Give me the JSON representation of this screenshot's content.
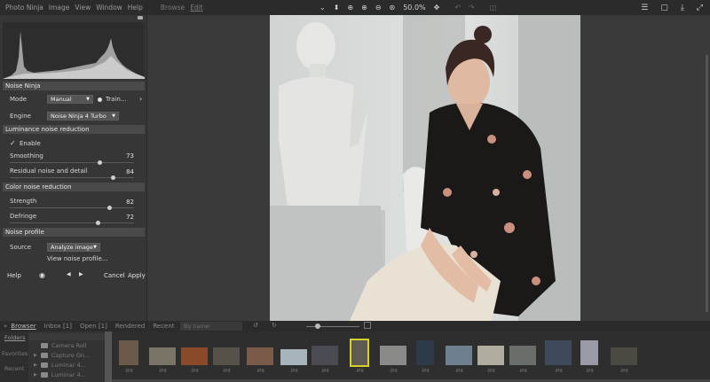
{
  "menu": [
    "Photo Ninja",
    "Image",
    "View",
    "Window",
    "Help"
  ],
  "menu2": [
    "Browse",
    "Edit"
  ],
  "toolbar": {
    "zoom": "50.0%",
    "icons": [
      "pin-icon",
      "zoom-fit-icon",
      "zoom-in-icon",
      "zoom-out-icon",
      "zoom-actual-icon",
      "pan-icon",
      "undo-icon",
      "redo-icon",
      "compare-icon"
    ]
  },
  "panel": {
    "title": "Noise Ninja",
    "mode_label": "Mode",
    "mode_value": "Manual",
    "train_label": "Train...",
    "engine_label": "Engine",
    "engine_value": "Noise Ninja 4 Turbo",
    "luminance": {
      "title": "Luminance noise reduction",
      "enable_label": "Enable",
      "enabled": true,
      "smoothing_label": "Smoothing",
      "smoothing_value": "73",
      "residual_label": "Residual noise and detail",
      "residual_value": "84"
    },
    "color": {
      "title": "Color noise reduction",
      "strength_label": "Strength",
      "strength_value": "82",
      "defringe_label": "Defringe",
      "defringe_value": "72"
    },
    "profile": {
      "title": "Noise profile",
      "source_label": "Source",
      "source_value": "Analyze image",
      "view_label": "View noise profile..."
    },
    "footer": {
      "help": "Help",
      "cancel": "Cancel",
      "apply": "Apply"
    }
  },
  "browser": {
    "tabs": [
      "Browser",
      "Inbox [1]",
      "Open [1]",
      "Rendered",
      "Recent"
    ],
    "search_placeholder": "By name",
    "side_tabs": [
      "Folders",
      "Favorites",
      "Recent"
    ],
    "folders": [
      "Camera Roll",
      "Capture On...",
      "Luminar 4...",
      "Luminar 4..."
    ],
    "thumbs": [
      {
        "cap": ".jpg",
        "color": "#6b5a4a"
      },
      {
        "cap": ".jpg",
        "color": "#7a7466"
      },
      {
        "cap": ".jpg",
        "color": "#8a4a2a"
      },
      {
        "cap": ".jpg",
        "color": "#56524a"
      },
      {
        "cap": ".jpg",
        "color": "#7a5a48"
      },
      {
        "cap": ".jpg",
        "color": "#a8b4bc"
      },
      {
        "cap": ".jpg",
        "color": "#4a4a52"
      },
      {
        "cap": ".jpg",
        "color": "#5e5a50"
      },
      {
        "cap": ".jpg",
        "color": "#8a8a88"
      },
      {
        "cap": ".jpg",
        "color": "#2e3a4a"
      },
      {
        "cap": ".jpg",
        "color": "#6e8090"
      },
      {
        "cap": ".jpg",
        "color": "#b0aca0"
      },
      {
        "cap": ".jpg",
        "color": "#6a6e6a"
      },
      {
        "cap": ".jpg",
        "color": "#3e4a5a"
      },
      {
        "cap": ".jpg",
        "color": "#9a9aa6"
      },
      {
        "cap": ".jpg",
        "color": "#4a4a42"
      }
    ]
  }
}
